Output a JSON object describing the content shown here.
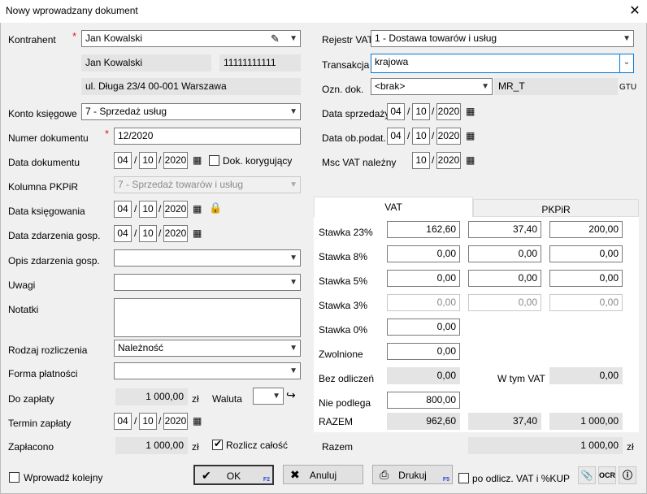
{
  "window": {
    "title": "Nowy wprowadzany dokument"
  },
  "left": {
    "kontrahent": {
      "label": "Kontrahent",
      "value": "Jan Kowalski",
      "name": "Jan Kowalski",
      "nip": "11111111111",
      "address": "ul. Długa 23/4 00-001 Warszawa"
    },
    "konto": {
      "label": "Konto księgowe",
      "value": "7 - Sprzedaż usług"
    },
    "numer": {
      "label": "Numer dokumentu",
      "value": "12/2020"
    },
    "data_dok": {
      "label": "Data dokumentu",
      "d": "04",
      "m": "10",
      "y": "2020",
      "korekta": "Dok. korygujący"
    },
    "kolumna": {
      "label": "Kolumna PKPiR",
      "value": "7 - Sprzedaż towarów i usług"
    },
    "data_ksieg": {
      "label": "Data księgowania",
      "d": "04",
      "m": "10",
      "y": "2020"
    },
    "data_zdarz": {
      "label": "Data zdarzenia gosp.",
      "d": "04",
      "m": "10",
      "y": "2020"
    },
    "opis": {
      "label": "Opis zdarzenia gosp."
    },
    "uwagi": {
      "label": "Uwagi"
    },
    "notatki": {
      "label": "Notatki"
    },
    "rodzaj": {
      "label": "Rodzaj rozliczenia",
      "value": "Należność"
    },
    "forma": {
      "label": "Forma płatności"
    },
    "do_zaplaty": {
      "label": "Do zapłaty",
      "value": "1 000,00",
      "unit": "zł",
      "waluta": "Waluta"
    },
    "termin": {
      "label": "Termin zapłaty",
      "d": "04",
      "m": "10",
      "y": "2020"
    },
    "zaplacono": {
      "label": "Zapłacono",
      "value": "1 000,00",
      "unit": "zł",
      "rozlicz": "Rozlicz całość"
    }
  },
  "right": {
    "rejestr": {
      "label": "Rejestr VAT",
      "value": "1 - Dostawa towarów i usług"
    },
    "transakcja": {
      "label": "Transakcja",
      "value": "krajowa"
    },
    "ozn": {
      "label": "Ozn. dok.",
      "value": "<brak>",
      "extra": "MR_T",
      "gtu": "GTU"
    },
    "data_sprz": {
      "label": "Data sprzedaży",
      "d": "04",
      "m": "10",
      "y": "2020"
    },
    "data_ob": {
      "label": "Data ob.podat.",
      "d": "04",
      "m": "10",
      "y": "2020"
    },
    "msc_vat": {
      "label": "Msc VAT należny",
      "m": "10",
      "y": "2020"
    }
  },
  "tabs": {
    "vat": "VAT",
    "pkpir": "PKPiR"
  },
  "vat_table": {
    "rows": [
      {
        "label": "Stawka 23%",
        "v1": "162,60",
        "v2": "37,40",
        "v3": "200,00"
      },
      {
        "label": "Stawka 8%",
        "v1": "0,00",
        "v2": "0,00",
        "v3": "0,00"
      },
      {
        "label": "Stawka 5%",
        "v1": "0,00",
        "v2": "0,00",
        "v3": "0,00"
      },
      {
        "label": "Stawka 3%",
        "v1": "0,00",
        "v2": "0,00",
        "v3": "0,00"
      },
      {
        "label": "Stawka 0%",
        "v1": "0,00"
      },
      {
        "label": "Zwolnione",
        "v1": "0,00"
      }
    ],
    "bez_odliczen": {
      "label": "Bez odliczeń",
      "value": "0,00",
      "wtym_label": "W tym VAT",
      "wtym_value": "0,00"
    },
    "nie_podlega": {
      "label": "Nie podlega",
      "value": "800,00"
    },
    "razem": {
      "label": "RAZEM",
      "v1": "962,60",
      "v2": "37,40",
      "v3": "1 000,00"
    },
    "razem_total": {
      "label": "Razem",
      "value": "1 000,00",
      "unit": "zł"
    }
  },
  "footer": {
    "wprowadz": "Wprowadź kolejny",
    "ok": "OK",
    "ok_key": "F2",
    "anuluj": "Anuluj",
    "drukuj": "Drukuj",
    "drukuj_key": "F5",
    "odlicz": "po odlicz. VAT i %KUP",
    "ocr": "OCR"
  }
}
